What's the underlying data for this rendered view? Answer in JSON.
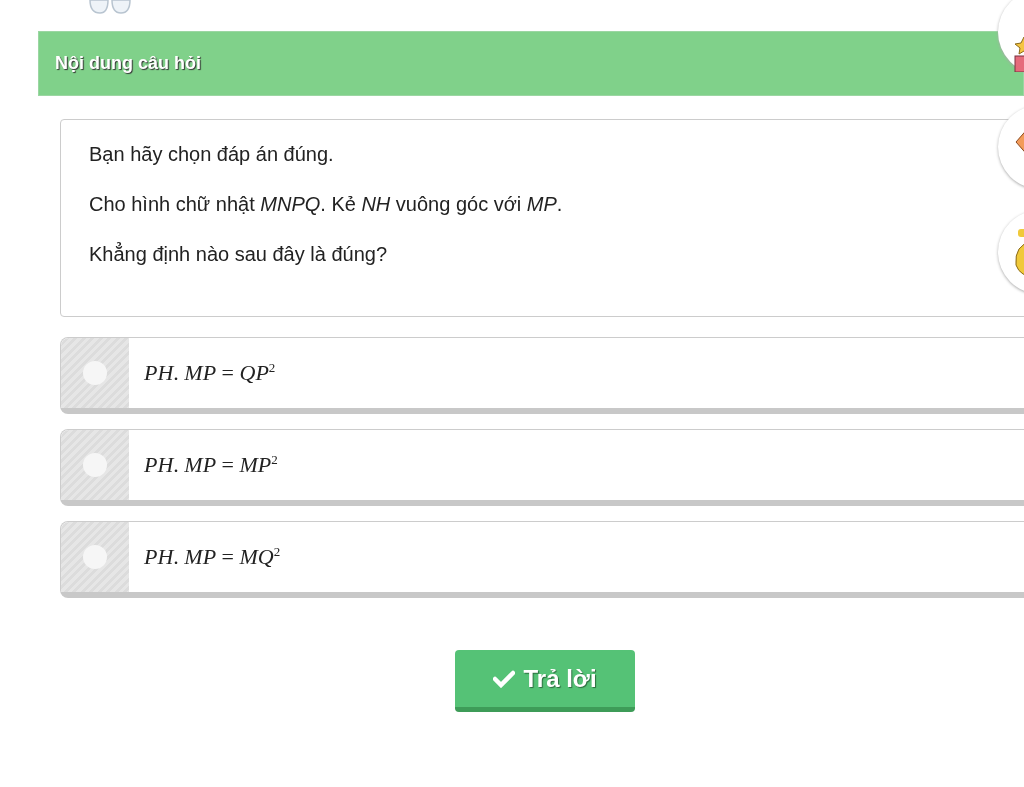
{
  "header": {
    "title": "Nội dung câu hỏi"
  },
  "question": {
    "lines": [
      "Bạn hãy chọn đáp án đúng.",
      "Cho hình chữ nhật *MNPQ*. Kẻ *NH* vuông góc với *MP*.",
      "Khẳng định nào sau đây là đúng?"
    ]
  },
  "options": [
    {
      "text": "*PH*. *MP* = *QP*$^{2}$",
      "selected": false
    },
    {
      "text": "*PH*. *MP* = *MP*$^{2}$",
      "selected": false
    },
    {
      "text": "*PH*. *MP* = *MQ*$^{2}$",
      "selected": false
    }
  ],
  "submit": {
    "label": "Trả lời"
  }
}
